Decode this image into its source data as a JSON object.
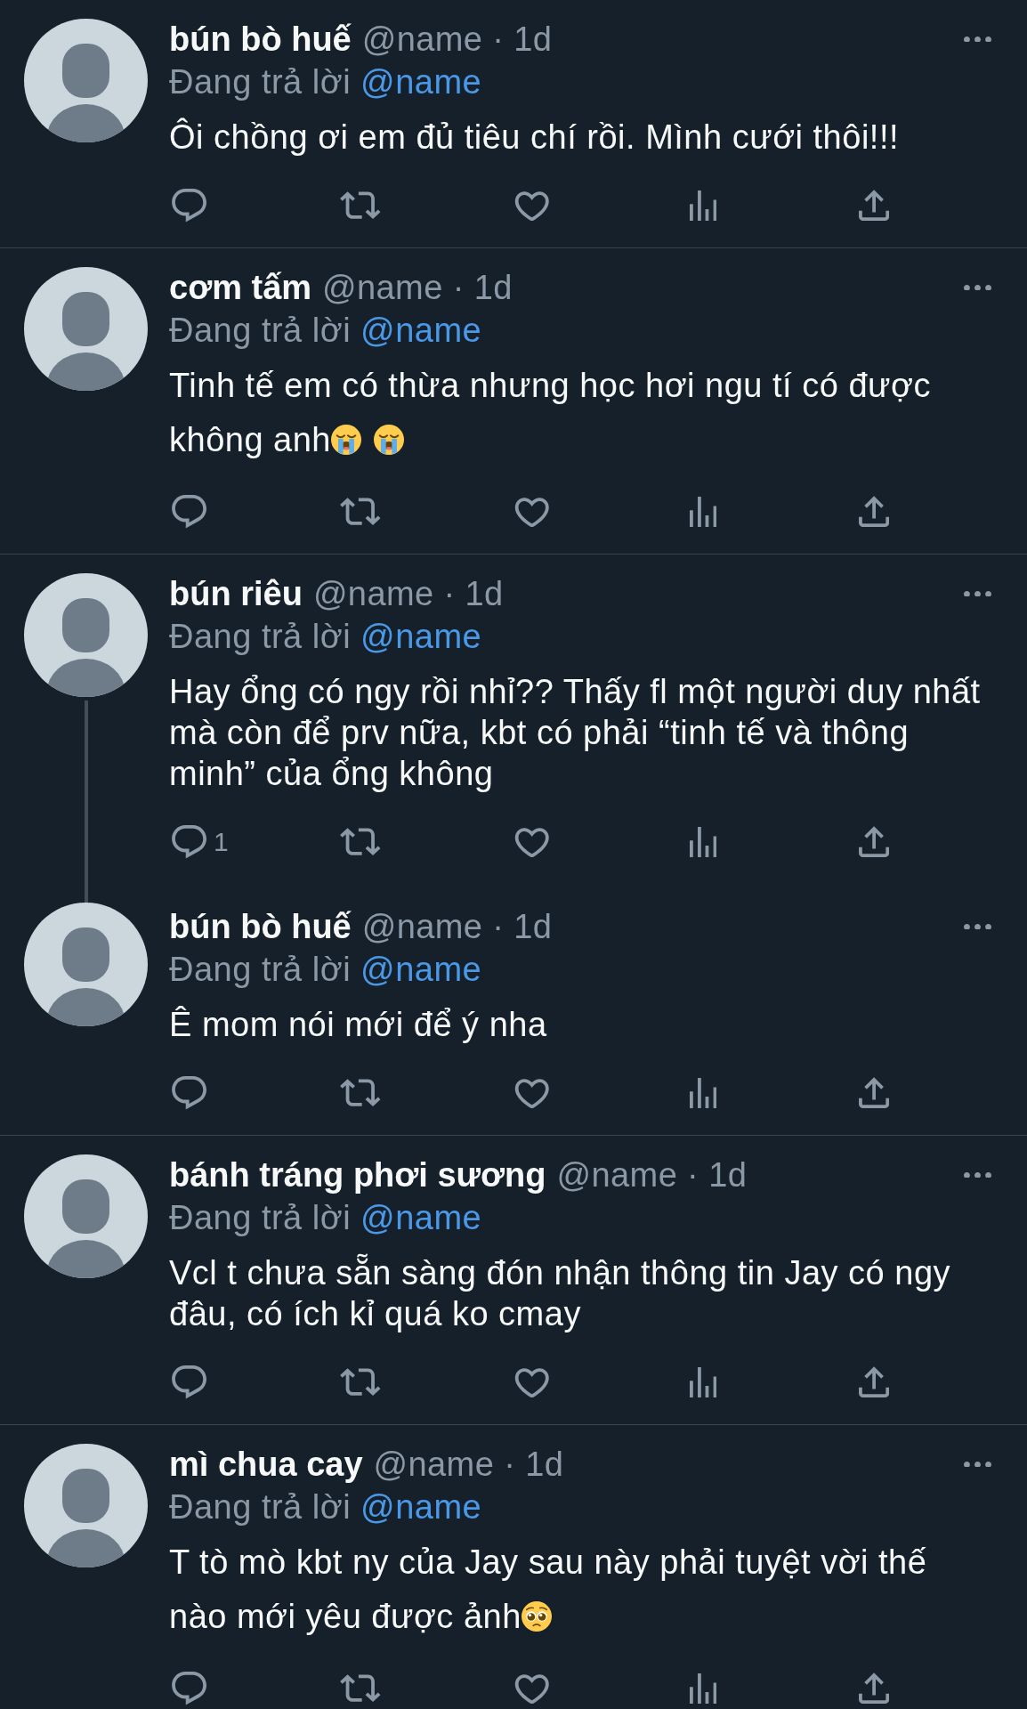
{
  "tweets": [
    {
      "name": "bún bò huế",
      "meta": "@name · 1d",
      "reply_label": "Đang trả lời",
      "reply_to": "@name",
      "text": [
        {
          "kind": "text",
          "text": "Ôi chồng ơi em đủ tiêu chí rồi. Mình cưới thôi!!!"
        }
      ],
      "thread_line": false
    },
    {
      "name": "cơm tấm",
      "meta": "@name · 1d",
      "reply_label": "Đang trả lời",
      "reply_to": "@name",
      "text": [
        {
          "kind": "text",
          "text": "Tinh tế em có thừa nhưng học hơi ngu tí có được không anh"
        },
        {
          "kind": "crying"
        },
        {
          "kind": "crying"
        }
      ],
      "thread_line": false
    },
    {
      "name": "bún riêu",
      "meta": "@name · 1d",
      "reply_label": "Đang trả lời",
      "reply_to": "@name",
      "text": [
        {
          "kind": "text",
          "text": "Hay ổng có ngy rồi nhỉ?? Thấy fl một người duy nhất mà còn để prv nữa, kbt có phải “tinh tế và thông minh” của ổng không"
        }
      ],
      "reply_count": "1",
      "thread_line": true
    },
    {
      "name": "bún bò huế",
      "meta": "@name · 1d",
      "reply_label": "Đang trả lời",
      "reply_to": "@name",
      "text": [
        {
          "kind": "text",
          "text": "Ê mom nói mới để ý nha"
        }
      ],
      "thread_line": false
    },
    {
      "name": "bánh tráng phơi sương",
      "meta": "@name · 1d",
      "reply_label": "Đang trả lời",
      "reply_to": "@name",
      "text": [
        {
          "kind": "text",
          "text": "Vcl t chưa sẵn sàng đón nhận thông tin Jay có ngy đâu, có ích kỉ quá ko cmay"
        }
      ],
      "thread_line": false
    },
    {
      "name": "mì chua cay",
      "meta": "@name · 1d",
      "reply_label": "Đang trả lời",
      "reply_to": "@name",
      "text": [
        {
          "kind": "text",
          "text": "T tò mò kbt ny của Jay sau này phải tuyệt vời thế nào mới yêu được ảnh"
        },
        {
          "kind": "pleading"
        }
      ],
      "thread_line": false
    }
  ]
}
